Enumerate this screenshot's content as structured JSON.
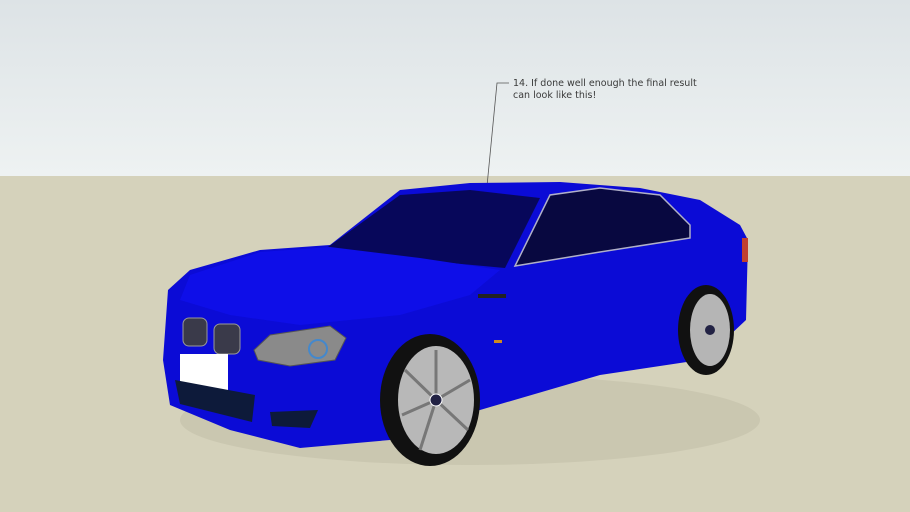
{
  "annotation": {
    "line1": "14. If done well enough the final result",
    "line2": "can look like this!"
  },
  "colors": {
    "sky": "#e4e9eb",
    "ground": "#d5d2bb",
    "car_body": "#0a0ad8",
    "glass": "#060640"
  }
}
